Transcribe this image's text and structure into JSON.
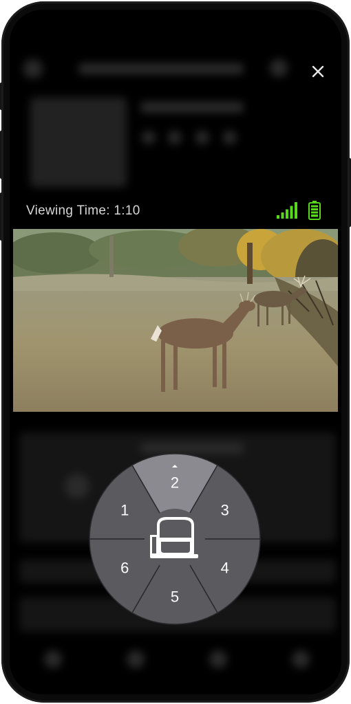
{
  "overlay": {
    "viewing_time": "Viewing Time: 1:10",
    "close_icon": "close-icon",
    "signal_icon": "signal-bars-icon",
    "battery_icon": "battery-full-icon",
    "signal_color": "#59d91b",
    "battery_color": "#59d91b"
  },
  "camera": {
    "image": "trail-camera-photo"
  },
  "dial": {
    "center_icon": "trail-camera-icon",
    "selected": "2",
    "segments": [
      {
        "label": "1"
      },
      {
        "label": "2"
      },
      {
        "label": "3"
      },
      {
        "label": "4"
      },
      {
        "label": "5"
      },
      {
        "label": "6"
      }
    ],
    "segment_color": "#5a5a5f",
    "selected_color": "#8a8a90"
  }
}
